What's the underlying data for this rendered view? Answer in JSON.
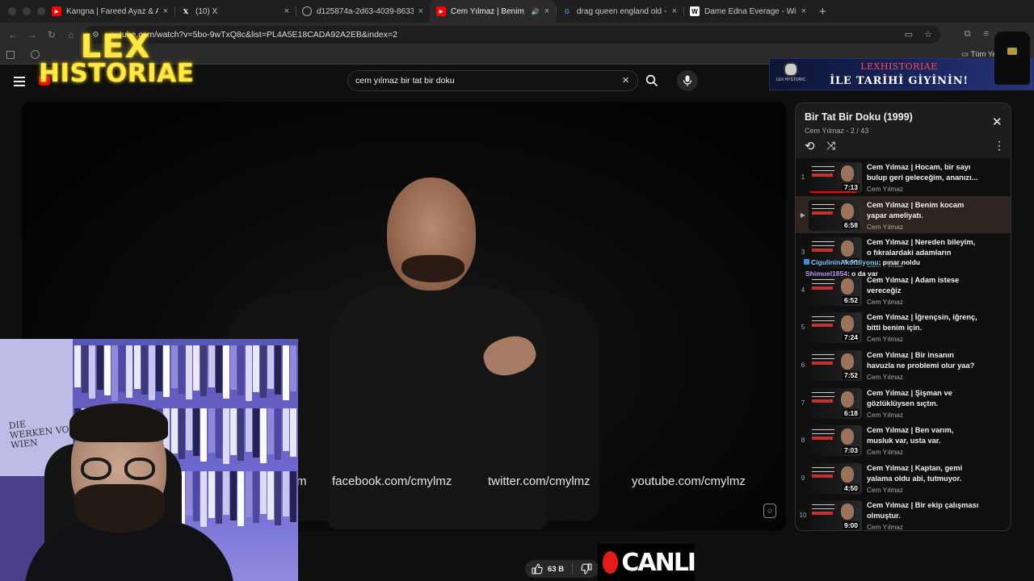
{
  "browser": {
    "tabs": [
      {
        "title": "Kangna | Fareed Ayaz & Abu M",
        "icon": "youtube-icon",
        "color": "#ff0000"
      },
      {
        "title": "(10) X",
        "icon": "x-icon",
        "color": "#000000"
      },
      {
        "title": "d125874a-2d63-4039-8633",
        "icon": "globe-icon",
        "color": "#555555"
      },
      {
        "title": "Cem Yılmaz | Benim kocam",
        "icon": "youtube-icon",
        "color": "#ff0000",
        "active": true
      },
      {
        "title": "drag queen england old - Goo",
        "icon": "google-icon",
        "color": "#4285f4"
      },
      {
        "title": "Dame Edna Everage - Wikipe",
        "icon": "wikipedia-icon",
        "color": "#ffffff"
      }
    ],
    "url": "youtube.com/watch?v=5bo-9wTxQ8c&list=PL4A5E18CADA92A2EB&index=2",
    "bookmark_folder": "Tüm Ye"
  },
  "youtube": {
    "search_query": "cem yılmaz bir tat bir doku"
  },
  "overlay": {
    "logo_line1": "LEX",
    "logo_line2": "HISTORIAE",
    "banner_brand": "LEX HYSTORIC",
    "banner_title": "LEXHISTORIAE",
    "banner_subtitle": "İLE TARİHİ GİYİNİN!",
    "live_label": "CANLI",
    "chat": [
      {
        "user": "CigulininAkordiyonu",
        "text": ": pınar noldu"
      },
      {
        "user": "Shimuel1854",
        "text": ": o da var"
      }
    ]
  },
  "player": {
    "captions": [
      "m",
      "facebook.com/cmylmz",
      "twitter.com/cmylmz",
      "youtube.com/cmylmz"
    ]
  },
  "playlist": {
    "title": "Bir Tat Bir Doku (1999)",
    "subtitle": "Cem Yılmaz - 2 / 43",
    "items": [
      {
        "index": "1",
        "title": "Cem Yılmaz | Hocam, bir sayı bulup geri geleceğim, ananızı...",
        "channel": "Cem Yılmaz",
        "duration": "7:13",
        "watched": 0.9
      },
      {
        "index": "▶",
        "title": "Cem Yılmaz | Benim kocam yapar ameliyatı.",
        "channel": "Cem Yılmaz",
        "duration": "6:58",
        "active": true
      },
      {
        "index": "3",
        "title": "Cem Yılmaz | Nereden bileyim, o fıkralardaki adamların gerçek...",
        "channel": "Cem Yılmaz",
        "duration": "8:03"
      },
      {
        "index": "4",
        "title": "Cem Yılmaz | Adam istese vereceğiz",
        "channel": "Cem Yılmaz",
        "duration": "6:52"
      },
      {
        "index": "5",
        "title": "Cem Yılmaz | İğrençsin, iğrenç, bitti benim için.",
        "channel": "Cem Yılmaz",
        "duration": "7:24"
      },
      {
        "index": "6",
        "title": "Cem Yılmaz | Bir insanın havuzla ne problemi olur yaa?",
        "channel": "Cem Yılmaz",
        "duration": "7:52"
      },
      {
        "index": "7",
        "title": "Cem Yılmaz | Şişman ve gözlüklüysen sıçtın.",
        "channel": "Cem Yılmaz",
        "duration": "6:18"
      },
      {
        "index": "8",
        "title": "Cem Yılmaz | Ben varım, musluk var, usta var.",
        "channel": "Cem Yılmaz",
        "duration": "7:03"
      },
      {
        "index": "9",
        "title": "Cem Yılmaz | Kaptan, gemi yalama oldu abi, tutmuyor.",
        "channel": "Cem Yılmaz",
        "duration": "4:50"
      },
      {
        "index": "10",
        "title": "Cem Yılmaz | Bir ekip çalışması olmuştur.",
        "channel": "Cem Yılmaz",
        "duration": "9:00"
      }
    ]
  },
  "actions": {
    "like_count": "63 B"
  },
  "webcam": {
    "poster_text": "DIE\nWERKEN VOR\nWIEN"
  }
}
